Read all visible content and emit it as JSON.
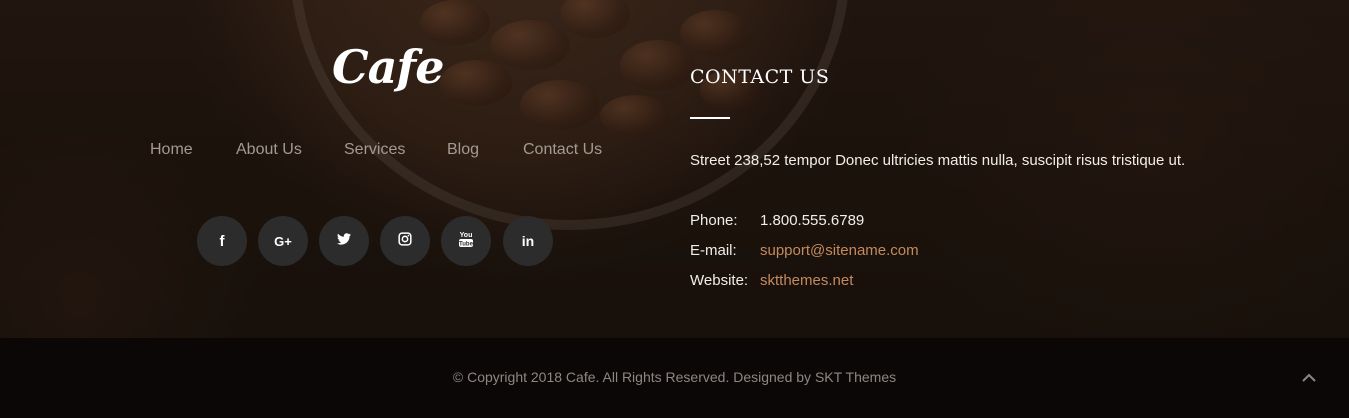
{
  "brand": {
    "logo_text": "Cafe"
  },
  "nav": {
    "items": [
      {
        "label": "Home"
      },
      {
        "label": "About Us"
      },
      {
        "label": "Services"
      },
      {
        "label": "Blog"
      },
      {
        "label": "Contact Us"
      }
    ]
  },
  "social": {
    "icons": [
      "facebook-icon",
      "google-plus-icon",
      "twitter-icon",
      "instagram-icon",
      "youtube-icon",
      "linkedin-icon"
    ],
    "glyphs": {
      "facebook": "f",
      "google_plus": "G+",
      "twitter": "t",
      "instagram": "◎",
      "youtube": "You Tube",
      "linkedin": "in"
    }
  },
  "contact": {
    "title": "CONTACT US",
    "address": "Street 238,52 tempor Donec ultricies mattis nulla, suscipit risus tristique ut.",
    "phone_label": "Phone:",
    "phone_value": "1.800.555.6789",
    "email_label": "E-mail:",
    "email_value": "support@sitename.com",
    "website_label": "Website:",
    "website_value": "sktthemes.net"
  },
  "footer": {
    "copyright_text": "© Copyright 2018 Cafe. All Rights Reserved. Designed by",
    "designer_link": "SKT Themes",
    "scroll_top_icon": "chevron-up-icon"
  },
  "colors": {
    "link": "#c48a5e",
    "bottom_bar": "#0b0706",
    "social_bg": "#2c2c2c"
  }
}
